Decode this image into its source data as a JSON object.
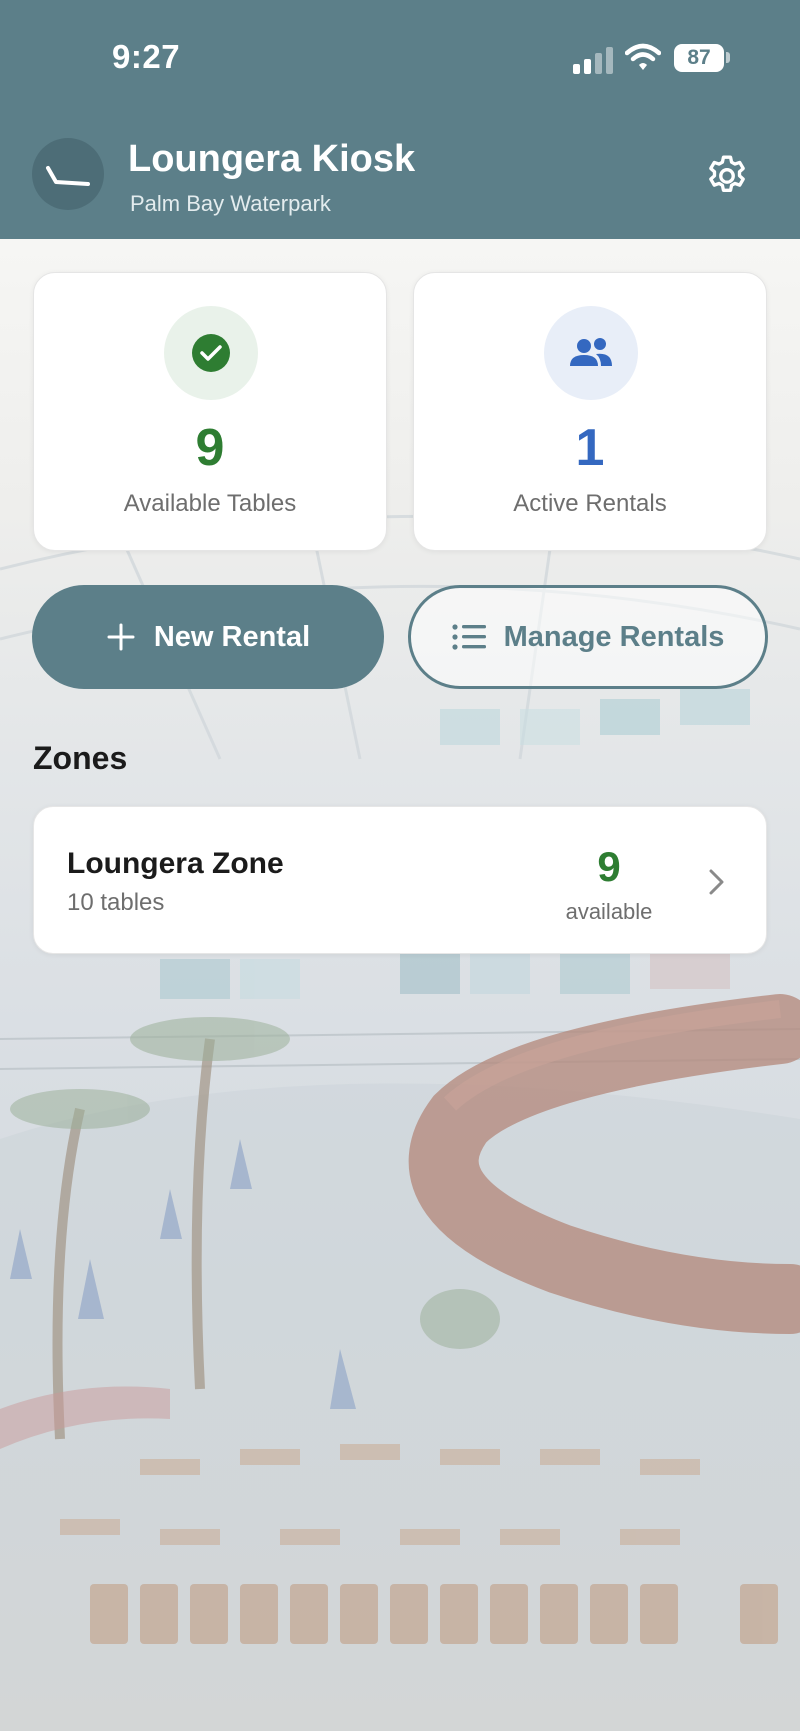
{
  "status_bar": {
    "time": "9:27",
    "battery": "87"
  },
  "header": {
    "title": "Loungera Kiosk",
    "subtitle": "Palm Bay Waterpark",
    "logo_icon": "lounge-chair-icon",
    "settings_icon": "gear-icon"
  },
  "stats": {
    "available": {
      "value": "9",
      "label": "Available Tables",
      "icon": "check-circle-icon",
      "color": "#2e7d32"
    },
    "active": {
      "value": "1",
      "label": "Active Rentals",
      "icon": "people-icon",
      "color": "#3468c0"
    }
  },
  "actions": {
    "new_rental": "New Rental",
    "manage_rentals": "Manage Rentals"
  },
  "zones": {
    "section_title": "Zones",
    "items": [
      {
        "name": "Loungera Zone",
        "tables": "10 tables",
        "available_count": "9",
        "available_label": "available"
      }
    ]
  },
  "colors": {
    "brand": "#5c7f89",
    "success": "#2e7d32",
    "info": "#3468c0"
  }
}
